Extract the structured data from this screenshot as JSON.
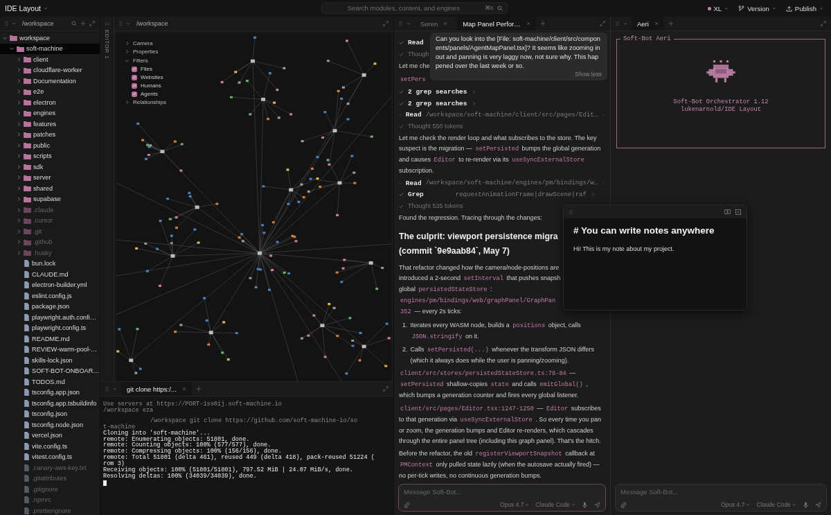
{
  "app": {
    "title": "IDE Layout"
  },
  "search": {
    "placeholder": "Search modules, content, and engines",
    "shortcut": "⌘K"
  },
  "topbar_actions": [
    {
      "kind": "size",
      "label": "XL"
    },
    {
      "kind": "version",
      "label": "Version"
    },
    {
      "kind": "publish",
      "label": "Publish"
    }
  ],
  "sidebar": {
    "path": "/workspace",
    "tree": [
      {
        "name": "workspace",
        "kind": "folder",
        "expanded": true,
        "selected": false,
        "dimmed": false,
        "children": [
          {
            "name": "soft-machine",
            "kind": "folder",
            "expanded": true,
            "selected": true,
            "dimmed": false,
            "children": [
              {
                "name": "client",
                "kind": "folder",
                "expanded": false,
                "selected": false,
                "dimmed": false
              },
              {
                "name": "cloudflare-worker",
                "kind": "folder",
                "expanded": false,
                "selected": false,
                "dimmed": false
              },
              {
                "name": "Documentation",
                "kind": "folder",
                "expanded": false,
                "selected": false,
                "dimmed": false
              },
              {
                "name": "e2e",
                "kind": "folder",
                "expanded": false,
                "selected": false,
                "dimmed": false
              },
              {
                "name": "electron",
                "kind": "folder",
                "expanded": false,
                "selected": false,
                "dimmed": false
              },
              {
                "name": "engines",
                "kind": "folder",
                "expanded": false,
                "selected": false,
                "dimmed": false
              },
              {
                "name": "features",
                "kind": "folder",
                "expanded": false,
                "selected": false,
                "dimmed": false
              },
              {
                "name": "patches",
                "kind": "folder",
                "expanded": false,
                "selected": false,
                "dimmed": false
              },
              {
                "name": "public",
                "kind": "folder",
                "expanded": false,
                "selected": false,
                "dimmed": false
              },
              {
                "name": "scripts",
                "kind": "folder",
                "expanded": false,
                "selected": false,
                "dimmed": false
              },
              {
                "name": "sdk",
                "kind": "folder",
                "expanded": false,
                "selected": false,
                "dimmed": false
              },
              {
                "name": "server",
                "kind": "folder",
                "expanded": false,
                "selected": false,
                "dimmed": false
              },
              {
                "name": "shared",
                "kind": "folder",
                "expanded": false,
                "selected": false,
                "dimmed": false
              },
              {
                "name": "supabase",
                "kind": "folder",
                "expanded": false,
                "selected": false,
                "dimmed": false
              },
              {
                "name": ".claude",
                "kind": "folder",
                "expanded": false,
                "selected": false,
                "dimmed": true
              },
              {
                "name": ".cursor",
                "kind": "folder",
                "expanded": false,
                "selected": false,
                "dimmed": true
              },
              {
                "name": ".git",
                "kind": "folder",
                "expanded": false,
                "selected": false,
                "dimmed": true
              },
              {
                "name": ".github",
                "kind": "folder",
                "expanded": false,
                "selected": false,
                "dimmed": true
              },
              {
                "name": ".husky",
                "kind": "folder",
                "expanded": false,
                "selected": false,
                "dimmed": true
              },
              {
                "name": "bun.lock",
                "kind": "file",
                "selected": false,
                "dimmed": false
              },
              {
                "name": "CLAUDE.md",
                "kind": "file",
                "selected": false,
                "dimmed": false
              },
              {
                "name": "electron-builder.yml",
                "kind": "file",
                "selected": false,
                "dimmed": false
              },
              {
                "name": "eslint.config.js",
                "kind": "file",
                "selected": false,
                "dimmed": false
              },
              {
                "name": "package.json",
                "kind": "file",
                "selected": false,
                "dimmed": false
              },
              {
                "name": "playwright.auth.confi…",
                "kind": "file",
                "selected": false,
                "dimmed": false
              },
              {
                "name": "playwright.config.ts",
                "kind": "file",
                "selected": false,
                "dimmed": false
              },
              {
                "name": "README.md",
                "kind": "file",
                "selected": false,
                "dimmed": false
              },
              {
                "name": "REVIEW-warm-pool-…",
                "kind": "file",
                "selected": false,
                "dimmed": false
              },
              {
                "name": "skills-lock.json",
                "kind": "file",
                "selected": false,
                "dimmed": false
              },
              {
                "name": "SOFT-BOT-ONBOAR…",
                "kind": "file",
                "selected": false,
                "dimmed": false
              },
              {
                "name": "TODOS.md",
                "kind": "file",
                "selected": false,
                "dimmed": false
              },
              {
                "name": "tsconfig.app.json",
                "kind": "file",
                "selected": false,
                "dimmed": false
              },
              {
                "name": "tsconfig.app.tsbuildinfo",
                "kind": "file",
                "selected": false,
                "dimmed": false
              },
              {
                "name": "tsconfig.json",
                "kind": "file",
                "selected": false,
                "dimmed": false
              },
              {
                "name": "tsconfig.node.json",
                "kind": "file",
                "selected": false,
                "dimmed": false
              },
              {
                "name": "vercel.json",
                "kind": "file",
                "selected": false,
                "dimmed": false
              },
              {
                "name": "vite.config.ts",
                "kind": "file",
                "selected": false,
                "dimmed": false
              },
              {
                "name": "vitest.config.ts",
                "kind": "file",
                "selected": false,
                "dimmed": false
              },
              {
                "name": ".canary-aws-key.txt",
                "kind": "file",
                "selected": false,
                "dimmed": true
              },
              {
                "name": ".gitattributes",
                "kind": "file",
                "selected": false,
                "dimmed": true
              },
              {
                "name": ".gitignore",
                "kind": "file",
                "selected": false,
                "dimmed": true
              },
              {
                "name": ".npmrc",
                "kind": "file",
                "selected": false,
                "dimmed": true
              },
              {
                "name": ".prettierignore",
                "kind": "file",
                "selected": false,
                "dimmed": true
              }
            ]
          }
        ]
      }
    ]
  },
  "editor": {
    "rail_label": "EDITOR 1",
    "path": "/workspace",
    "graph_controls": [
      {
        "label": "Camera",
        "expanded": false
      },
      {
        "label": "Properties",
        "expanded": false
      },
      {
        "label": "Filters",
        "expanded": true,
        "children": [
          {
            "label": "Files",
            "checked": true
          },
          {
            "label": "Websites",
            "checked": true
          },
          {
            "label": "Humans",
            "checked": true
          },
          {
            "label": "Agents",
            "checked": true
          }
        ]
      },
      {
        "label": "Relationships",
        "expanded": false
      }
    ]
  },
  "terminal": {
    "tabs": [
      {
        "label": "git clone https:/...",
        "selected": true
      }
    ],
    "lines": [
      {
        "text": "Use servers at https://PORT-1ss0ij.soft-machine.io",
        "dim": true,
        "indent": false
      },
      {
        "text": "/workspace eza",
        "dim": true,
        "indent": false
      },
      {
        "text": "/workspace git clone https://github.com/soft-machine-io/so",
        "dim": true,
        "indent": true
      },
      {
        "text": "t-machine",
        "dim": true,
        "indent": false
      },
      {
        "text": "Cloning into 'soft-machine'...",
        "dim": false,
        "indent": false
      },
      {
        "text": "remote: Enumerating objects: 51801, done.",
        "dim": false,
        "indent": false
      },
      {
        "text": "remote: Counting objects: 100% (577/577), done.",
        "dim": false,
        "indent": false
      },
      {
        "text": "remote: Compressing objects: 100% (156/156), done.",
        "dim": false,
        "indent": false
      },
      {
        "text": "remote: Total 51801 (delta 461), reused 449 (delta 418), pack-reused 51224 (",
        "dim": false,
        "indent": false
      },
      {
        "text": "rom 3)",
        "dim": false,
        "indent": false
      },
      {
        "text": "Receiving objects: 100% (51801/51801), 797.52 MiB | 24.07 MiB/s, done.",
        "dim": false,
        "indent": false
      },
      {
        "text": "Resolving deltas: 100% (34039/34039), done.",
        "dim": false,
        "indent": false
      }
    ]
  },
  "chat": {
    "tabs": [
      {
        "label": "Seren",
        "selected": false
      },
      {
        "label": "Map Panel Perfor…",
        "selected": true
      }
    ],
    "message": {
      "text": "Can you look into the [File: soft-machine/client/src/components/panels/AgentMapPanel.tsx]? It seems like zooming in out and panning is very laggy now, not sure why. This happened over the last week or so.",
      "toggle": "Show less"
    },
    "items": [
      {
        "kind": "tool",
        "name": "Read",
        "expandable": false
      },
      {
        "kind": "thought",
        "text": "Though"
      },
      {
        "kind": "para",
        "parts": [
          {
            "t": "Let me che"
          }
        ]
      },
      {
        "kind": "para",
        "parts": [
          {
            "t": "setPers",
            "code": true
          }
        ]
      },
      {
        "kind": "tool",
        "name": "2 grep searches",
        "expandable": true
      },
      {
        "kind": "tool",
        "name": "2 grep searches",
        "expandable": true
      },
      {
        "kind": "tool",
        "name": "Read",
        "detail": "/workspace/soft-machine/client/src/pages/Edit…",
        "expandable": true
      },
      {
        "kind": "thought",
        "text": "Thought 550 tokens"
      },
      {
        "kind": "para",
        "parts": [
          {
            "t": "Let me check the render loop and what subscribes to the store. The key suspect is the migration — "
          },
          {
            "t": "setPersisted",
            "code": true
          },
          {
            "t": " bumps the global generation and causes "
          },
          {
            "t": "Editor",
            "code": true
          },
          {
            "t": " to re-render via its "
          },
          {
            "t": "useSyncExternalStore",
            "code": true
          },
          {
            "t": " subscription."
          }
        ]
      },
      {
        "kind": "tool",
        "name": "Read",
        "detail": "/workspace/soft-machine/engines/pm/bindings/w…",
        "expandable": true
      },
      {
        "kind": "tool",
        "name": "Grep",
        "detail": "requestAnimationFrame|drawScene|raf",
        "expandable": true
      },
      {
        "kind": "thought",
        "text": "Thought 535 tokens"
      },
      {
        "kind": "para",
        "parts": [
          {
            "t": "Found the regression. Tracing through the changes:"
          }
        ]
      },
      {
        "kind": "heading",
        "lines": [
          "The culprit: viewport persistence migra",
          "(commit `9e9aab84`, May 7)"
        ]
      },
      {
        "kind": "lines",
        "lines": [
          [
            {
              "t": "That refactor changed how the camera/node-positions are"
            }
          ],
          [
            {
              "t": "introduced a 2-second "
            },
            {
              "t": "setInterval",
              "code": true
            },
            {
              "t": " that pushes snapsh"
            }
          ],
          [
            {
              "t": "global "
            },
            {
              "t": "persistedStateStore",
              "code": true
            },
            {
              "t": " :"
            }
          ],
          [
            {
              "t": "engines/pm/bindings/web/graphPanel/GraphPan",
              "code": true
            }
          ],
          [
            {
              "t": "352",
              "code": true
            },
            {
              "t": " — every 2s ticks:"
            }
          ]
        ]
      },
      {
        "kind": "list",
        "entries": [
          {
            "num": "1.",
            "parts": [
              {
                "t": "Iterates every WASM node, builds a "
              },
              {
                "t": "positions",
                "code": true
              },
              {
                "t": " object, calls "
              },
              {
                "t": "JSON.stringify",
                "code": true
              },
              {
                "t": " on it."
              }
            ]
          },
          {
            "num": "2.",
            "parts": [
              {
                "t": "Calls "
              },
              {
                "t": "setPersisted(...)",
                "code": true
              },
              {
                "t": " whenever the transform JSON differs (which it always does while the user is panning/zooming)."
              }
            ]
          }
        ]
      },
      {
        "kind": "para",
        "parts": [
          {
            "t": "client/src/stores/persistedStateStore.ts:78-84",
            "code": true
          },
          {
            "t": " — "
          },
          {
            "t": "setPersisted",
            "code": true
          },
          {
            "t": " shallow-copies "
          },
          {
            "t": "state",
            "code": true
          },
          {
            "t": " and calls "
          },
          {
            "t": "emitGlobal()",
            "code": true
          },
          {
            "t": " , which bumps a generation counter and fires every global listener."
          }
        ]
      },
      {
        "kind": "para",
        "parts": [
          {
            "t": "client/src/pages/Editor.tsx:1247-1250",
            "code": true
          },
          {
            "t": " — "
          },
          {
            "t": "Editor",
            "code": true
          },
          {
            "t": " subscribes to that generation via "
          },
          {
            "t": "useSyncExternalStore",
            "code": true
          },
          {
            "t": " . So every time you pan or zoom, the generation bumps and Editor re-renders, which cascades through the entire panel tree (including this graph panel). That's the hitch."
          }
        ]
      },
      {
        "kind": "para",
        "parts": [
          {
            "t": "Before the refactor, the old "
          },
          {
            "t": "registerViewportSnapshot",
            "code": true
          },
          {
            "t": " callback at "
          },
          {
            "t": "PMContext",
            "code": true
          },
          {
            "t": " only pulled state lazily (when the autosave actually fired) — no per-tick writes, no continuous generation bumps."
          }
        ]
      }
    ],
    "composer": {
      "placeholder": "Message Soft-Bot...",
      "model": "Opus 4.7",
      "mode": "Claude Code",
      "focused": true
    }
  },
  "right": {
    "tabs": [
      {
        "label": "Aeri",
        "selected": true
      }
    ],
    "banner": {
      "legend": "Soft-Bot Aeri",
      "title": "Soft-Bot Orchestrator 1.12",
      "subtitle": "lukenarnold/IDE Layout"
    },
    "composer": {
      "placeholder": "Message Soft-Bot...",
      "model": "Opus 4.7",
      "mode": "Claude Code",
      "focused": false
    }
  },
  "note": {
    "title": "# You can write notes anywhere",
    "body": "Hi! This is my note about my project."
  }
}
